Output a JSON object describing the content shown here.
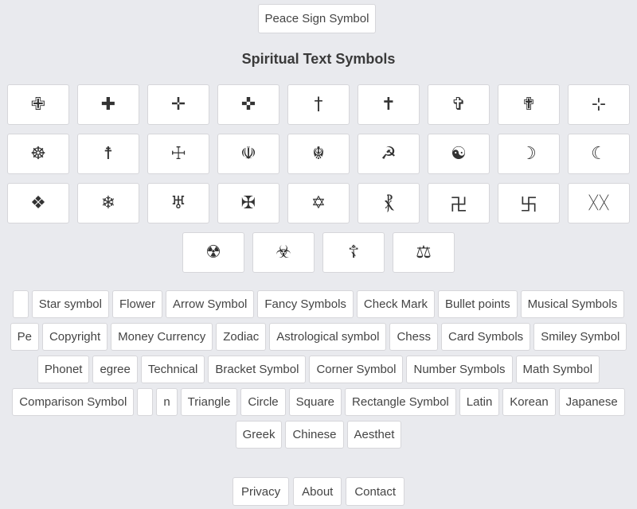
{
  "top_button": "Peace Sign Symbol",
  "section_title": "Spiritual Text Symbols",
  "symbols": [
    [
      "✙",
      "✚",
      "✛",
      "✜",
      "†",
      "✝",
      "✞",
      "✟",
      "⊹"
    ],
    [
      "☸",
      "☨",
      "☩",
      "☫",
      "☬",
      "☭",
      "☯",
      "☽",
      "☾"
    ],
    [
      "❖",
      "❄",
      "♅",
      "✠",
      "✡",
      "⳩",
      "卍",
      "卐",
      "ᚷᚷ"
    ],
    [
      "☢",
      "☣",
      "☦",
      "⚖"
    ]
  ],
  "tag_rows": [
    [
      "",
      "Star symbol",
      "Flower",
      "Arrow Symbol",
      "Fancy Symbols",
      "Check Mark",
      "Bullet points",
      "Musical Symbols",
      "Pe"
    ],
    [
      "Copyright",
      "Money Currency",
      "Zodiac",
      "Astrological symbol",
      "Chess",
      "Card Symbols",
      "Smiley Symbol",
      "Phonet"
    ],
    [
      "egree",
      "Technical",
      "Bracket Symbol",
      "Corner Symbol",
      "Number Symbols",
      "Math Symbol",
      "Comparison Symbol",
      ""
    ],
    [
      "n",
      "Triangle",
      "Circle",
      "Square",
      "Rectangle Symbol",
      "Latin",
      "Korean",
      "Japanese",
      "Greek",
      "Chinese",
      "Aesthet"
    ]
  ],
  "footer": [
    "Privacy",
    "About",
    "Contact"
  ]
}
